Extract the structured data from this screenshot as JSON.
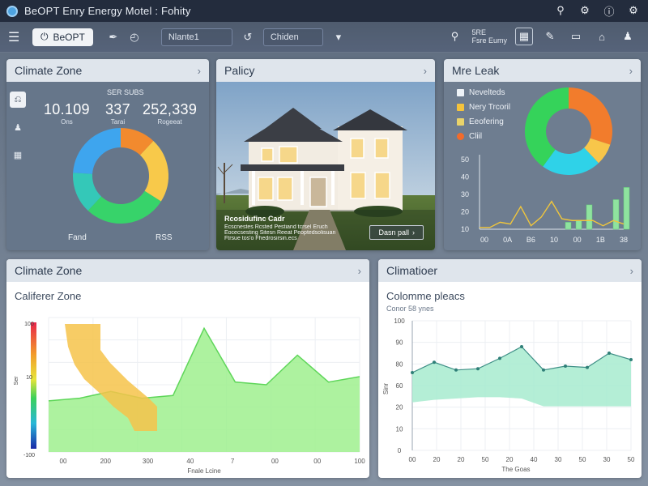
{
  "window": {
    "title": "BeOPT Enry Energy Motel : Fohity"
  },
  "toolbar": {
    "app_button_label": "BeOPT",
    "field_1": "Nlante1",
    "field_2": "Chiden",
    "stack_label_1": "5RE",
    "stack_label_2": "Fsre Eumy"
  },
  "panels": {
    "climate_zone": {
      "title": "Climate Zone",
      "stats_header": "SER SUBS",
      "stats": [
        {
          "value": "10.109",
          "label": "Ons"
        },
        {
          "value": "337",
          "label": "Tarai"
        },
        {
          "value": "252,339",
          "label": "Rogeeat"
        }
      ],
      "foot_left": "Fand",
      "foot_right": "RSS"
    },
    "policy": {
      "title": "Palicy",
      "caption_title": "Rcosidufinc Cadr",
      "caption_lines": [
        "Ecscnestes Rcsted Pestiand tcrsel Eruch",
        "Eocecsesting Sitesn Reeat Peoptedsolisuan",
        "Ftrsue tos'o Fhedrosirsin.ecs"
      ],
      "button_label": "Dasn pall"
    },
    "leak": {
      "title": "Mre Leak",
      "legend": [
        {
          "label": "Nevelteds",
          "color": "#eef3f8"
        },
        {
          "label": "Nery Trcoril",
          "color": "#f5c33b"
        },
        {
          "label": "Eeofering",
          "color": "#e9d36a"
        },
        {
          "label": "Cliil",
          "color": "#f26b2b"
        }
      ],
      "y_ticks": [
        "50",
        "40",
        "30",
        "20",
        "10"
      ],
      "x_ticks": [
        "00",
        "0A",
        "B6",
        "10",
        "00",
        "1B",
        "38"
      ]
    },
    "climate_zone_2": {
      "title": "Climate Zone",
      "subtitle": "Califerer Zone",
      "scale_top": "100",
      "scale_mid": "10",
      "scale_bottom": "-100",
      "scale_axis": "Ser",
      "x_ticks": [
        "00",
        "200",
        "300",
        "40",
        "7",
        "00",
        "00",
        "100"
      ],
      "xlabel": "Fnale Lcine"
    },
    "climatior": {
      "title": "Climatioer",
      "subtitle": "Colomme pleacs",
      "subsubtitle": "Conor 58 ynes",
      "y_ticks": [
        "100",
        "90",
        "80",
        "60",
        "20",
        "10",
        "0"
      ],
      "y_axis_label": "Sinr",
      "x_ticks": [
        "00",
        "20",
        "20",
        "50",
        "20",
        "40",
        "30",
        "50",
        "30",
        "50"
      ],
      "xlabel": "The Goas"
    }
  },
  "chart_data": [
    {
      "type": "pie",
      "title": "",
      "categories": [
        "orange",
        "yellow",
        "green",
        "teal",
        "blue"
      ],
      "values": [
        12,
        22,
        28,
        14,
        24
      ]
    },
    {
      "type": "pie",
      "title": "",
      "categories": [
        "orange",
        "yellow",
        "teal",
        "green"
      ],
      "values": [
        30,
        8,
        22,
        40
      ]
    },
    {
      "type": "line",
      "title": "",
      "ylim": [
        10,
        50
      ],
      "x": [
        0,
        1,
        2,
        3,
        4,
        5,
        6,
        7,
        8,
        9,
        10,
        11,
        12,
        13,
        14
      ],
      "series": [
        {
          "values": [
            11,
            11,
            14,
            13,
            23,
            12,
            17,
            26,
            16,
            15,
            15,
            15,
            12,
            15,
            13
          ]
        }
      ],
      "bars": [
        4,
        5,
        14,
        17,
        24
      ]
    },
    {
      "type": "area",
      "title": "",
      "xlabel": "Fnale Lcine",
      "ylim": [
        0,
        100
      ],
      "x": [
        0,
        1,
        2,
        3,
        4,
        5,
        6,
        7,
        8,
        9,
        10
      ],
      "series": [
        {
          "values": [
            38,
            40,
            45,
            40,
            42,
            92,
            52,
            50,
            72,
            52,
            56
          ]
        }
      ]
    },
    {
      "type": "area",
      "title": "",
      "xlabel": "The Goas",
      "ylim": [
        0,
        100
      ],
      "x": [
        0,
        1,
        2,
        3,
        4,
        5,
        6,
        7,
        8,
        9,
        10
      ],
      "series": [
        {
          "values": [
            60,
            68,
            62,
            63,
            71,
            80,
            62,
            65,
            64,
            75,
            70
          ]
        },
        {
          "values": [
            37,
            39,
            40,
            41,
            41,
            40,
            34,
            34,
            34,
            34,
            34
          ]
        }
      ]
    }
  ]
}
